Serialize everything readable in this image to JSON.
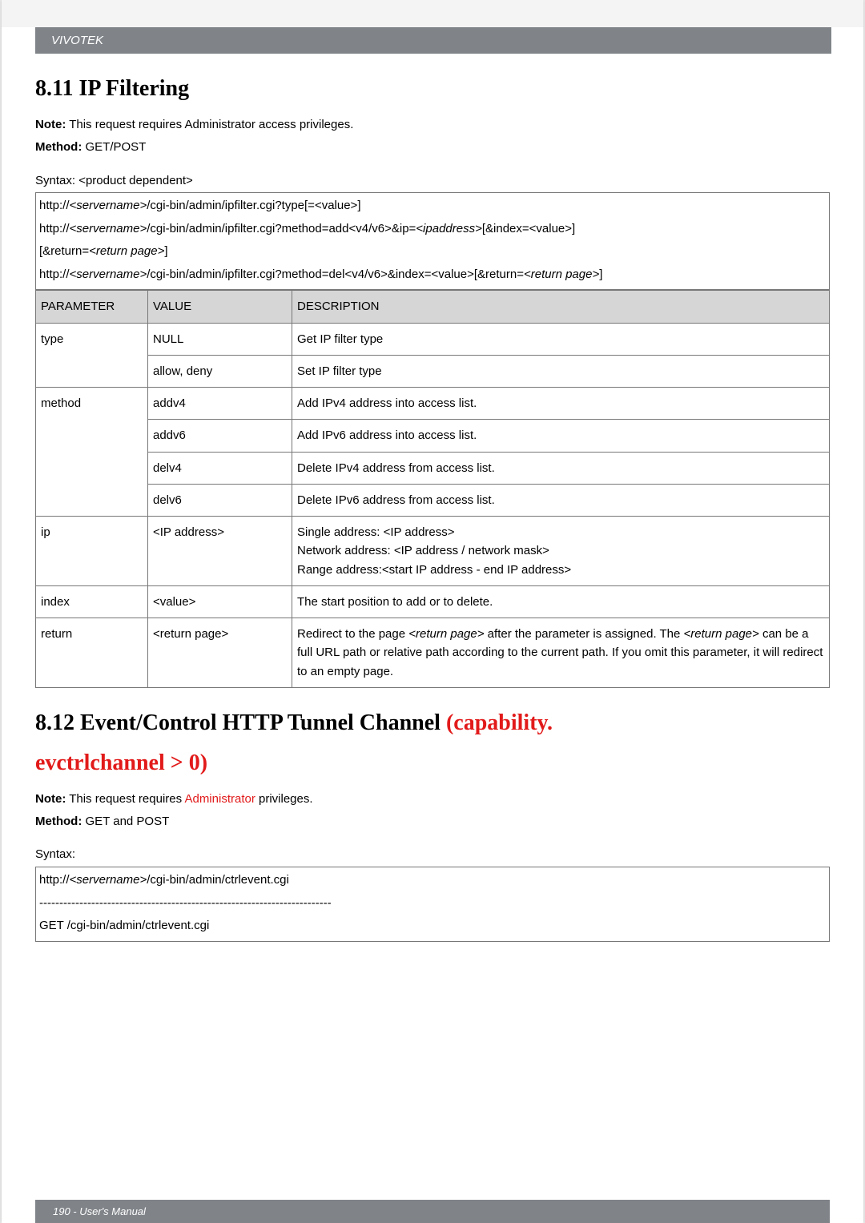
{
  "brand": "VIVOTEK",
  "section_811_title": "8.11 IP Filtering",
  "section_811_note_label": "Note:",
  "section_811_note_text": " This request requires Administrator access privileges.",
  "section_811_method_label": "Method:",
  "section_811_method_text": " GET/POST",
  "syntax_intro": "Syntax: <product dependent>",
  "syntax_lines": [
    "http://<servername>/cgi-bin/admin/ipfilter.cgi?type[=<value>]",
    "http://<servername>/cgi-bin/admin/ipfilter.cgi?method=add<v4/v6>&ip=<ipaddress>[&index=<value>][&return=<return page>]",
    "http://<servername>/cgi-bin/admin/ipfilter.cgi?method=del<v4/v6>&index=<value>[&return=<return page>]"
  ],
  "param_headers": {
    "c0": "PARAMETER",
    "c1": "VALUE",
    "c2": "DESCRIPTION"
  },
  "rows": [
    {
      "p": "type",
      "v": "NULL",
      "d": "Get IP filter type"
    },
    {
      "p": "",
      "v": "allow, deny",
      "d": "Set IP filter type"
    },
    {
      "p": "method",
      "v": "addv4",
      "d": "Add IPv4 address into access list."
    },
    {
      "p": "",
      "v": "addv6",
      "d": "Add IPv6 address into access list."
    },
    {
      "p": "",
      "v": "delv4",
      "d": "Delete IPv4 address from access list."
    },
    {
      "p": "",
      "v": "delv6",
      "d": "Delete IPv6 address from access list."
    },
    {
      "p": "ip",
      "v": "<IP address>",
      "d": "Single address: <IP address>\nNetwork address: <IP address / network mask>\nRange address:<start IP address - end IP address>"
    },
    {
      "p": "index",
      "v": "<value>",
      "d": "The start position to add or to delete."
    },
    {
      "p": "return",
      "v": "<return page>",
      "d": "Redirect to the page <return page> after the parameter is assigned. The <return page> can be a full URL path or relative path according to the current path. If you omit this parameter, it will redirect to an empty page."
    }
  ],
  "section_812_title_black": "8.12 Event/Control HTTP Tunnel Channel ",
  "section_812_title_red": "(capability.",
  "section_812_subtitle_red": "evctrlchannel > 0)",
  "section_812_note_label": "Note:",
  "section_812_note_text_pre": " This request requires ",
  "section_812_note_admin": "Administrator",
  "section_812_note_text_post": " privileges.",
  "section_812_method_label": "Method:",
  "section_812_method_text": " GET and POST",
  "syntax2_label": "Syntax:",
  "syntax2_lines": [
    "http://<servername>/cgi-bin/admin/ctrlevent.cgi",
    "-------------------------------------------------------------------------",
    "GET /cgi-bin/admin/ctrlevent.cgi"
  ],
  "footer": "190 - User's Manual"
}
